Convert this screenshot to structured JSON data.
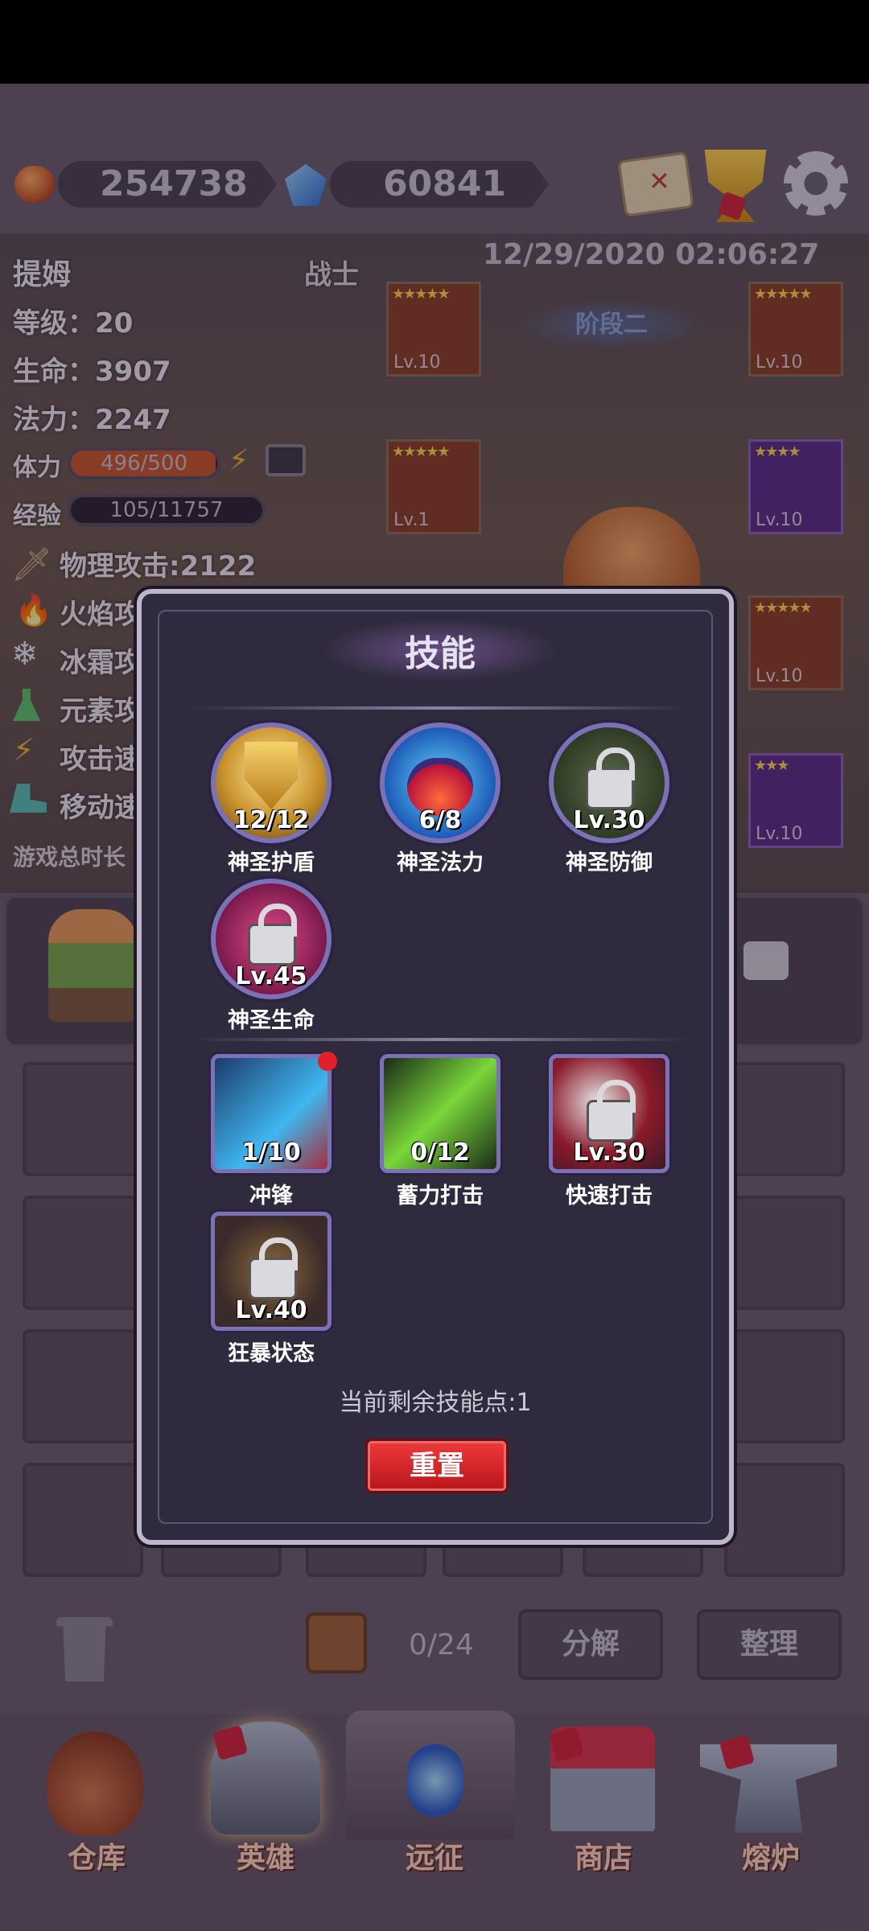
{
  "resources": {
    "coins": "254738",
    "gems": "60841"
  },
  "hero": {
    "name": "提姆",
    "class": "战士",
    "datetime": "12/29/2020 02:06:27",
    "stage": "阶段二",
    "level": "等级：20",
    "hp": "生命：3907",
    "mp": "法力：2247",
    "stamina_label": "体力",
    "stamina_value": "496/500",
    "exp_label": "经验",
    "exp_value": "105/11757",
    "physical_attack": "物理攻击:2122",
    "fire_attack": "火焰攻",
    "frost_attack": "冰霜攻",
    "element_attack": "元素攻",
    "attack_speed": "攻击速",
    "move_speed": "移动速",
    "total_time": "游戏总时长"
  },
  "equipment": [
    {
      "stars": "★★★★★",
      "level": "Lv.10",
      "rarity": "orange"
    },
    {
      "stars": "★★★★★",
      "level": "Lv.10",
      "rarity": "orange"
    },
    {
      "stars": "★★★★★",
      "level": "Lv.1",
      "rarity": "orange"
    },
    {
      "stars": "★★★★",
      "level": "Lv.10",
      "rarity": "purple"
    },
    {
      "stars": "★★★★★",
      "level": "Lv.10",
      "rarity": "orange"
    },
    {
      "stars": "★★★",
      "level": "Lv.10",
      "rarity": "purple"
    }
  ],
  "inventory": {
    "count": "0/24",
    "decompose": "分解",
    "sort": "整理"
  },
  "nav": {
    "warehouse": "仓库",
    "hero": "英雄",
    "expedition": "远征",
    "shop": "商店",
    "furnace": "熔炉"
  },
  "modal": {
    "title": "技能",
    "passive": [
      {
        "name": "神圣护盾",
        "value": "12/12",
        "icon": "lion-shield-icon",
        "locked": false
      },
      {
        "name": "神圣法力",
        "value": "6/8",
        "icon": "potion-icon",
        "locked": false
      },
      {
        "name": "神圣防御",
        "value": "Lv.30",
        "icon": "lock-icon",
        "locked": true
      },
      {
        "name": "神圣生命",
        "value": "Lv.45",
        "icon": "lock-icon",
        "locked": true
      }
    ],
    "active": [
      {
        "name": "冲锋",
        "value": "1/10",
        "icon": "charge-icon",
        "locked": false
      },
      {
        "name": "蓄力打击",
        "value": "0/12",
        "icon": "power-strike-icon",
        "locked": false
      },
      {
        "name": "快速打击",
        "value": "Lv.30",
        "icon": "lock-icon",
        "locked": true
      },
      {
        "name": "狂暴状态",
        "value": "Lv.40",
        "icon": "lock-icon",
        "locked": true
      }
    ],
    "remaining_points": "当前剩余技能点:1",
    "reset": "重置"
  },
  "colors": {
    "accent_red": "#d4232b",
    "modal_bg": "#2f2a3d",
    "frame": "#7b71b6"
  }
}
